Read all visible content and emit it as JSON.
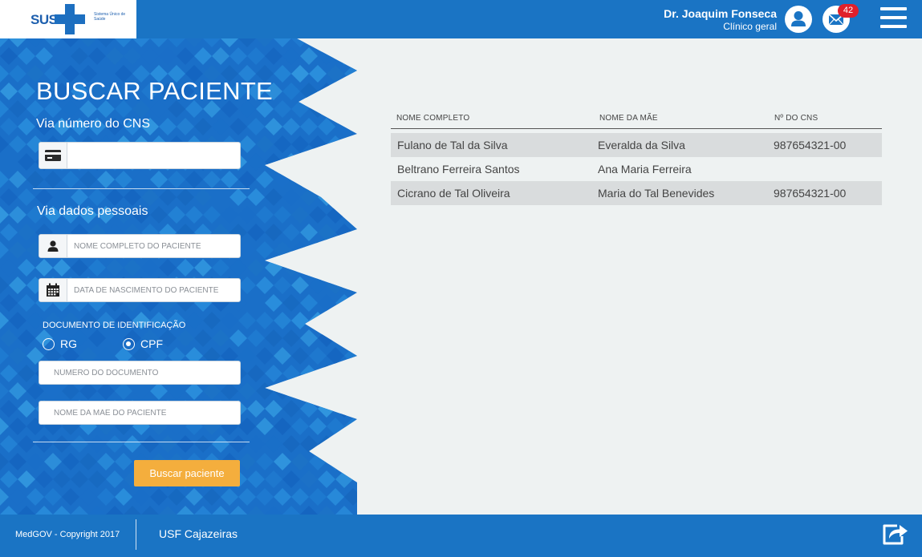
{
  "header": {
    "logo": {
      "text": "SUS",
      "subtitle": "Sistema Único de Saúde"
    },
    "user": {
      "name": "Dr. Joaquim Fonseca",
      "role": "Clínico geral"
    },
    "messages_count": "42",
    "colors": {
      "bar": "#1a74c4",
      "badge": "#e0202a"
    },
    "icons": [
      "user-icon",
      "mail-icon",
      "menu-icon"
    ]
  },
  "search_panel": {
    "title": "BUSCAR PACIENTE",
    "cns_section_label": "Via número do CNS",
    "cns_input": {
      "value": "",
      "placeholder": ""
    },
    "personal_section_label": "Via dados pessoais",
    "name_input": {
      "placeholder": "NOME COMPLETO DO PACIENTE"
    },
    "birthdate_input": {
      "placeholder": "DATA DE NASCIMENTO DO PACIENTE"
    },
    "document_label": "DOCUMENTO DE IDENTIFICAÇÃO",
    "document_types": [
      {
        "label": "RG",
        "checked": false
      },
      {
        "label": "CPF",
        "checked": true
      }
    ],
    "document_number_input": {
      "placeholder": "NÚMERO DO DOCUMENTO"
    },
    "mother_name_input": {
      "placeholder": "NOME DA MÃE DO PACIENTE"
    },
    "search_button": "Buscar paciente",
    "colors": {
      "button": "#f4ae3d",
      "tiles": "#1f7bd0"
    }
  },
  "results": {
    "columns": [
      "NOME COMPLETO",
      "NOME DA MÃE",
      "Nº DO CNS"
    ],
    "rows": [
      {
        "name": "Fulano de Tal da Silva",
        "mother": "Everalda da Silva",
        "cns": "987654321-00"
      },
      {
        "name": "Beltrano Ferreira Santos",
        "mother": "Ana Maria Ferreira",
        "cns": ""
      },
      {
        "name": "Cicrano de Tal Oliveira",
        "mother": "Maria do Tal Benevides",
        "cns": "987654321-00"
      }
    ]
  },
  "footer": {
    "copyright": "MedGOV - Copyright 2017",
    "unit": "USF Cajazeiras",
    "logout_icon": "share-exit-icon"
  }
}
